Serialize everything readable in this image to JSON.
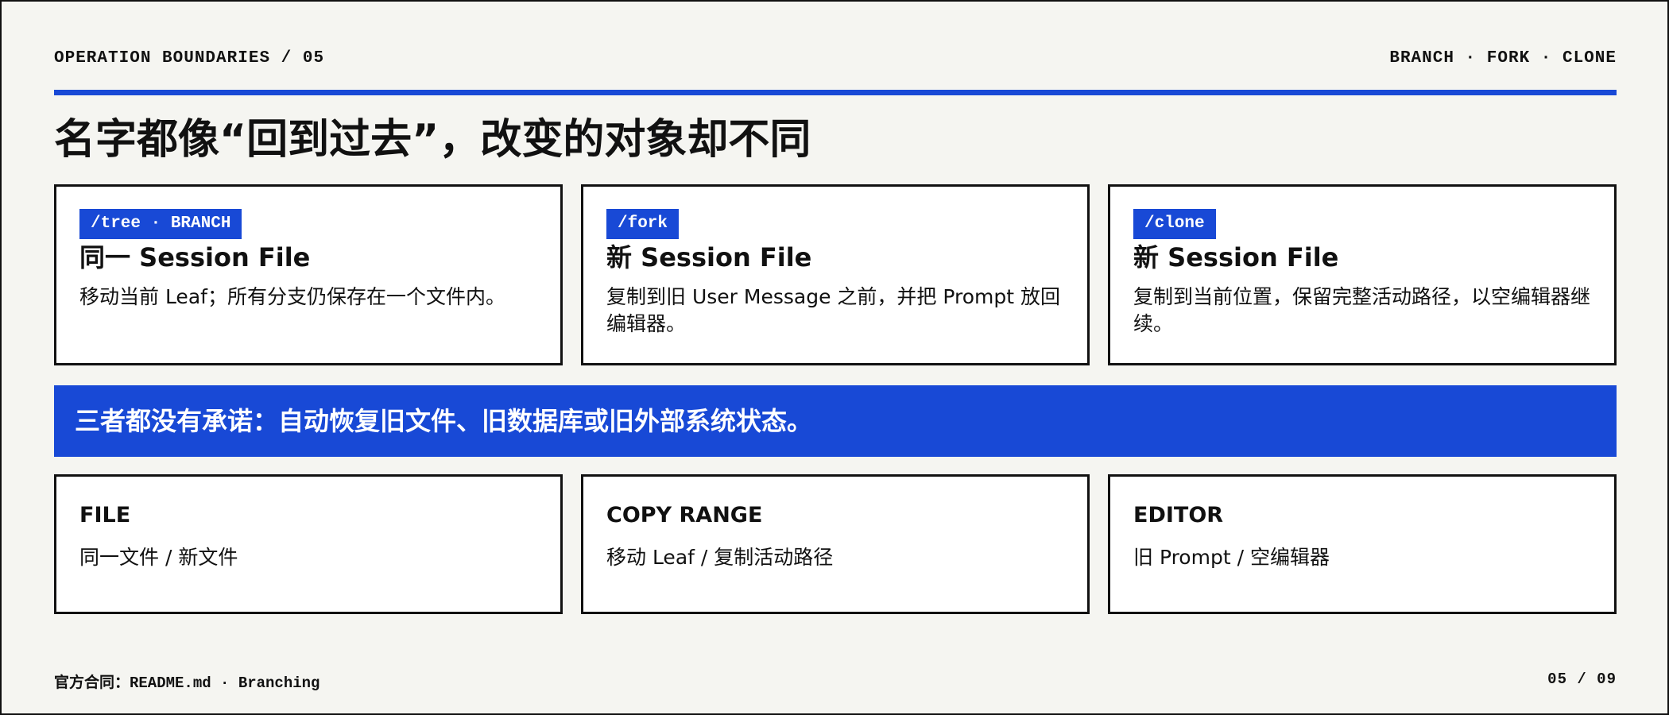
{
  "header": {
    "section_label": "OPERATION BOUNDARIES / 05",
    "topic_tags": "BRANCH · FORK · CLONE"
  },
  "title": "名字都像“回到过去”，改变的对象却不同",
  "cards": [
    {
      "tag": "/tree · BRANCH",
      "title": "同一 Session File",
      "description": "移动当前 Leaf；所有分支仍保存在一个文件内。"
    },
    {
      "tag": "/fork",
      "title": "新 Session File",
      "description": "复制到旧 User Message 之前，并把 Prompt 放回编辑器。"
    },
    {
      "tag": "/clone",
      "title": "新 Session File",
      "description": "复制到当前位置，保留完整活动路径，以空编辑器继续。"
    }
  ],
  "banner": {
    "text": "三者都没有承诺：自动恢复旧文件、旧数据库或旧外部系统状态。"
  },
  "comparisons": [
    {
      "label": "FILE",
      "value": "同一文件 / 新文件"
    },
    {
      "label": "COPY RANGE",
      "value": "移动 Leaf / 复制活动路径"
    },
    {
      "label": "EDITOR",
      "value": "旧 Prompt / 空编辑器"
    }
  ],
  "footer": {
    "source": "官方合同：README.md · Branching",
    "page": "05 / 09"
  },
  "colors": {
    "accent": "#1849d6",
    "background": "#f5f5f1",
    "border": "#111111"
  }
}
